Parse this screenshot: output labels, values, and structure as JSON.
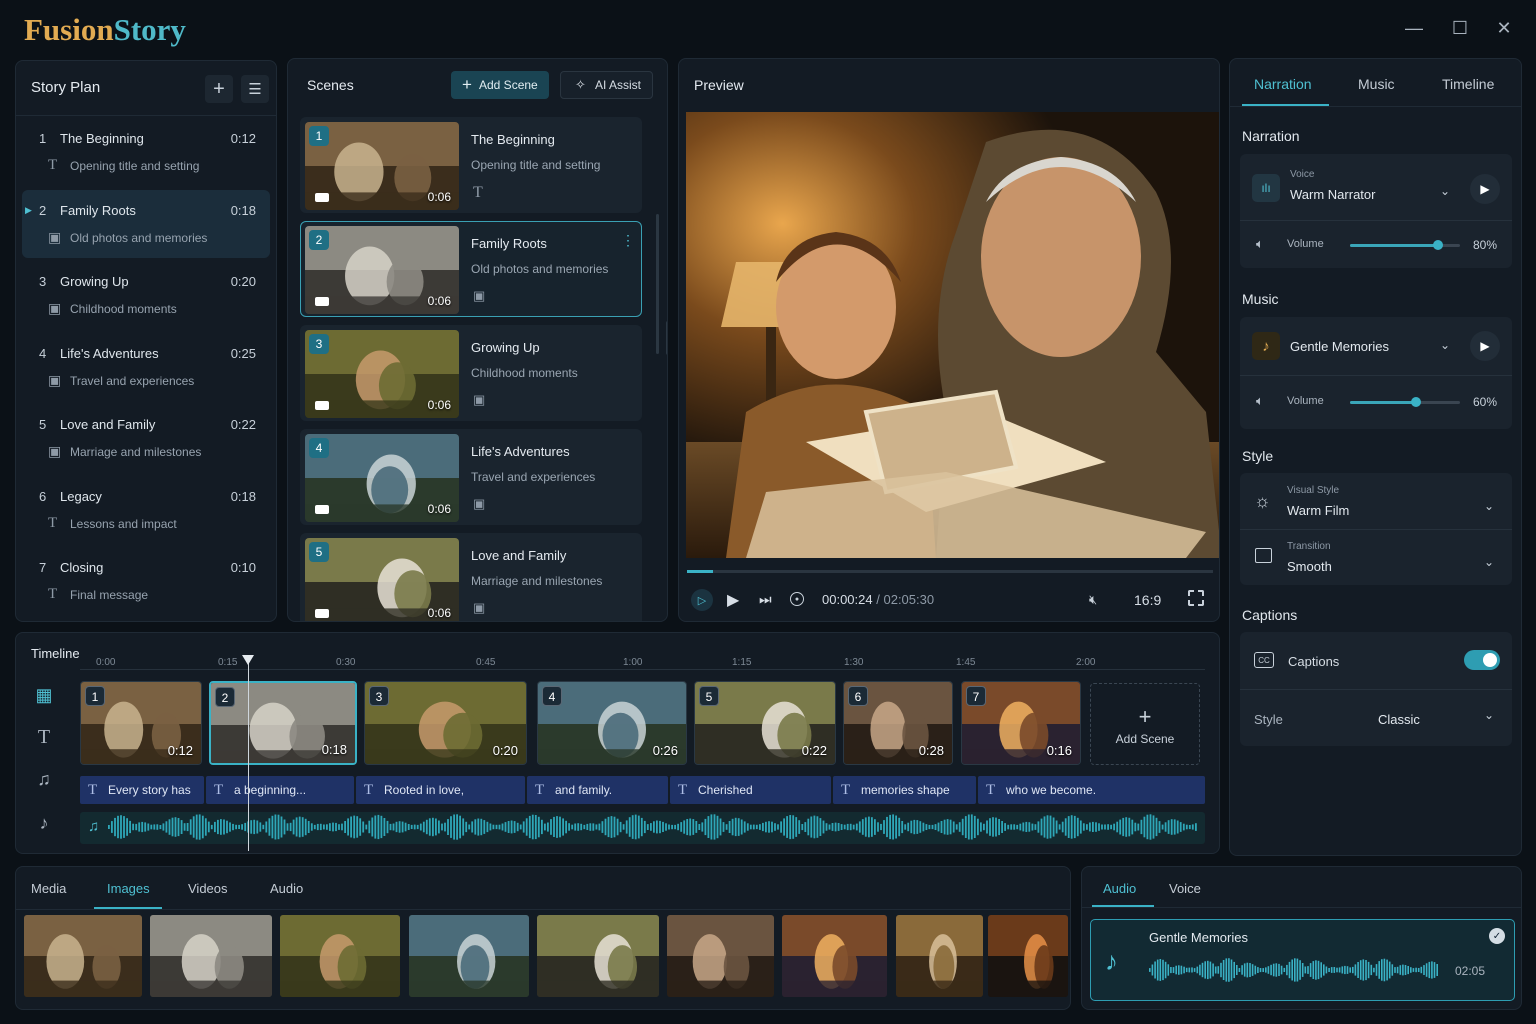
{
  "app": {
    "brand_a": "Fusion",
    "brand_b": "Story"
  },
  "window": {
    "minimize": "—",
    "maximize": "☐",
    "close": "✕"
  },
  "story_plan": {
    "title": "Story Plan",
    "items": [
      {
        "num": "1",
        "title": "The Beginning",
        "duration": "0:12",
        "subtitle": "Opening title and setting",
        "icon": "text-icon"
      },
      {
        "num": "2",
        "title": "Family Roots",
        "duration": "0:18",
        "subtitle": "Old photos and memories",
        "icon": "image-icon"
      },
      {
        "num": "3",
        "title": "Growing Up",
        "duration": "0:20",
        "subtitle": "Childhood moments",
        "icon": "image-icon"
      },
      {
        "num": "4",
        "title": "Life's Adventures",
        "duration": "0:25",
        "subtitle": "Travel and experiences",
        "icon": "image-icon"
      },
      {
        "num": "5",
        "title": "Love and Family",
        "duration": "0:22",
        "subtitle": "Marriage and milestones",
        "icon": "image-icon"
      },
      {
        "num": "6",
        "title": "Legacy",
        "duration": "0:18",
        "subtitle": "Lessons and impact",
        "icon": "text-icon"
      },
      {
        "num": "7",
        "title": "Closing",
        "duration": "0:10",
        "subtitle": "Final message",
        "icon": "text-icon"
      }
    ]
  },
  "scenes": {
    "title": "Scenes",
    "add_label": "Add Scene",
    "ai_label": "AI Assist",
    "items": [
      {
        "num": "1",
        "title": "The Beginning",
        "subtitle": "Opening title and setting",
        "duration": "0:06"
      },
      {
        "num": "2",
        "title": "Family Roots",
        "subtitle": "Old photos and memories",
        "duration": "0:06"
      },
      {
        "num": "3",
        "title": "Growing Up",
        "subtitle": "Childhood moments",
        "duration": "0:06"
      },
      {
        "num": "4",
        "title": "Life's Adventures",
        "subtitle": "Travel and experiences",
        "duration": "0:06"
      },
      {
        "num": "5",
        "title": "Love and Family",
        "subtitle": "Marriage and milestones",
        "duration": "0:06"
      }
    ]
  },
  "preview": {
    "title": "Preview",
    "current": "00:00:24",
    "separator": "/",
    "total": "02:05:30",
    "aspect": "16:9",
    "progress": 0.16
  },
  "right_tabs": [
    "Narration",
    "Music",
    "Timeline"
  ],
  "narration": {
    "heading": "Narration",
    "voice_label": "Voice",
    "voice": "Warm Narrator",
    "volume_label": "Volume",
    "volume": "80%",
    "volume_value": 0.8
  },
  "music": {
    "heading": "Music",
    "track": "Gentle Memories",
    "volume_label": "Volume",
    "volume": "60%",
    "volume_value": 0.6
  },
  "style": {
    "heading": "Style",
    "visual_label": "Visual Style",
    "visual": "Warm Film",
    "transition_label": "Transition",
    "transition": "Smooth"
  },
  "captions": {
    "heading": "Captions",
    "label": "Captions",
    "enabled": true,
    "style_label": "Style",
    "style": "Classic"
  },
  "timeline": {
    "title": "Timeline",
    "ticks": [
      "0:00",
      "0:15",
      "0:30",
      "0:45",
      "1:00",
      "1:15",
      "1:30",
      "1:45",
      "2:00"
    ],
    "clips": [
      {
        "num": "1",
        "duration": "0:12"
      },
      {
        "num": "2",
        "duration": "0:18"
      },
      {
        "num": "3",
        "duration": "0:20"
      },
      {
        "num": "4",
        "duration": "0:26"
      },
      {
        "num": "5",
        "duration": "0:22"
      },
      {
        "num": "6",
        "duration": "0:28"
      },
      {
        "num": "7",
        "duration": "0:16"
      }
    ],
    "add_label": "Add Scene",
    "captions": [
      "Every story has",
      "a beginning...",
      "Rooted in love,",
      "and family.",
      "Cherished",
      "memories shape",
      "who we become."
    ]
  },
  "media": {
    "tabs": [
      "Media",
      "Images",
      "Videos",
      "Audio"
    ],
    "active": "Images"
  },
  "audio_panel": {
    "tabs": [
      "Audio",
      "Voice"
    ],
    "track": "Gentle Memories",
    "duration": "02:05"
  },
  "colors": {
    "accent": "#3ab2c6",
    "brand_gold": "#e2ab52",
    "caption_bar": "#1f3266"
  }
}
